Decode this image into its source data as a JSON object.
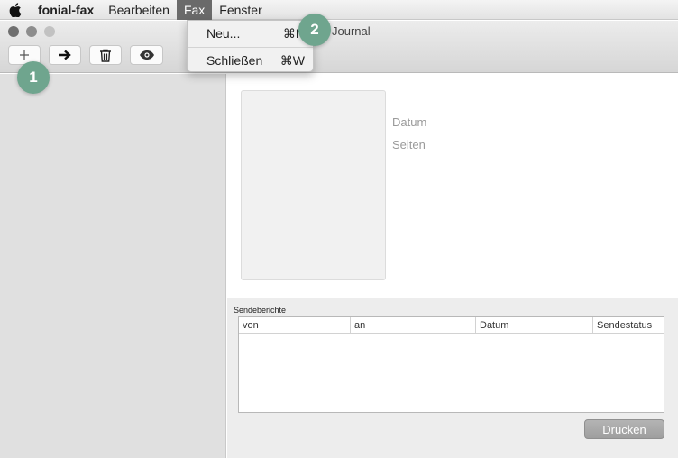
{
  "menubar": {
    "app_name": "fonial-fax",
    "items": [
      "Bearbeiten",
      "Fax",
      "Fenster"
    ]
  },
  "window": {
    "title": "Journal"
  },
  "toolbar": {
    "icons": [
      "plus-icon",
      "arrow-right-icon",
      "trash-icon",
      "eye-icon"
    ]
  },
  "fax_menu": {
    "items": [
      {
        "label": "Neu...",
        "shortcut": "⌘N"
      },
      {
        "label": "Schließen",
        "shortcut": "⌘W"
      }
    ]
  },
  "detail": {
    "date_label": "Datum",
    "pages_label": "Seiten"
  },
  "reports": {
    "section_label": "Sendeberichte",
    "columns": [
      "von",
      "an",
      "Datum",
      "Sendestatus"
    ],
    "rows": []
  },
  "print_button": "Drucken",
  "callouts": [
    "1",
    "2"
  ],
  "colors": {
    "callout": "#6fa58e",
    "menu_highlight": "#6a6a6a",
    "button_disabled": "#a8a8a8"
  }
}
